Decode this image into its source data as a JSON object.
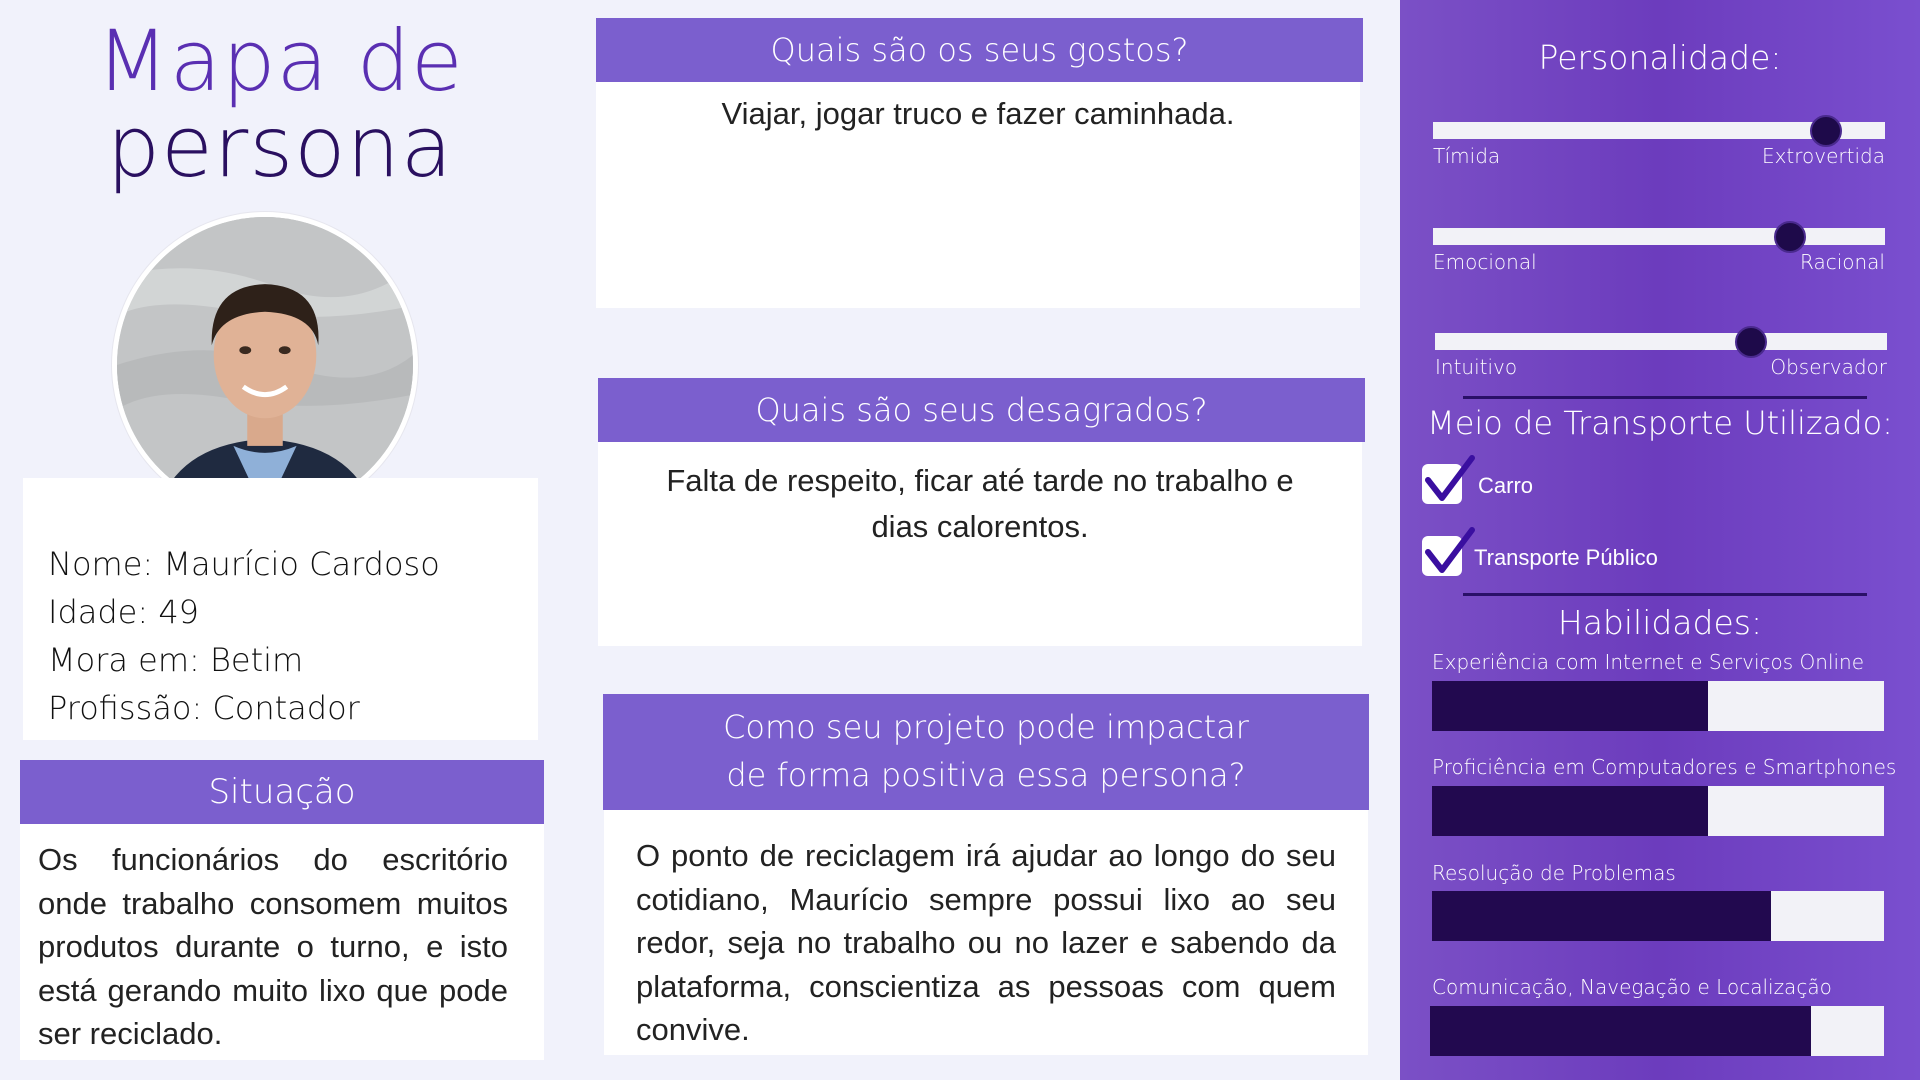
{
  "title": {
    "line1": "Mapa de",
    "line2": "persona"
  },
  "profile": {
    "name": "Nome: Maurício Cardoso",
    "age": "Idade: 49",
    "city": "Mora em: Betim",
    "job": "Profissão: Contador"
  },
  "situation": {
    "heading": "Situação",
    "text": "Os funcionários do escritório onde trabalho consomem muitos produtos durante o turno, e isto está gerando muito lixo que pode ser reciclado."
  },
  "likes": {
    "heading": "Quais são os seus gostos?",
    "text": "Viajar, jogar truco e fazer caminhada."
  },
  "dislikes": {
    "heading": "Quais são seus desagrados?",
    "text": "Falta de respeito, ficar até tarde no trabalho e dias calorentos."
  },
  "impact": {
    "heading_line1": "Como seu projeto pode impactar",
    "heading_line2": "de forma positiva essa persona?",
    "text": "O ponto de reciclagem irá ajudar ao longo do seu cotidiano, Maurício sempre possui lixo ao seu redor, seja no trabalho ou no lazer e sabendo da plataforma, conscientiza as pessoas com quem convive."
  },
  "personality": {
    "heading": "Personalidade:",
    "sliders": [
      {
        "left": "Tímida",
        "right": "Extrovertida",
        "value": 0.87
      },
      {
        "left": "Emocional",
        "right": "Racional",
        "value": 0.79
      },
      {
        "left": "Intuitivo",
        "right": "Observador",
        "value": 0.7
      }
    ]
  },
  "transport": {
    "heading": "Meio de Transporte Utilizado:",
    "options": [
      {
        "label": "Carro",
        "checked": true
      },
      {
        "label": "Transporte Público",
        "checked": true
      }
    ]
  },
  "skills": {
    "heading": "Habilidades:",
    "items": [
      {
        "label": "Experiência com Internet e Serviços Online",
        "value": 0.61
      },
      {
        "label": "Proficiência em Computadores e Smartphones",
        "value": 0.61
      },
      {
        "label": "Resolução de Problemas",
        "value": 0.75
      },
      {
        "label": "Comunicação, Navegação e Localização",
        "value": 0.84
      }
    ]
  },
  "colors": {
    "accent": "#7b5fce",
    "sidebar": "#6c3cbd",
    "dark": "#22094f",
    "title": "#5a2fb2"
  }
}
